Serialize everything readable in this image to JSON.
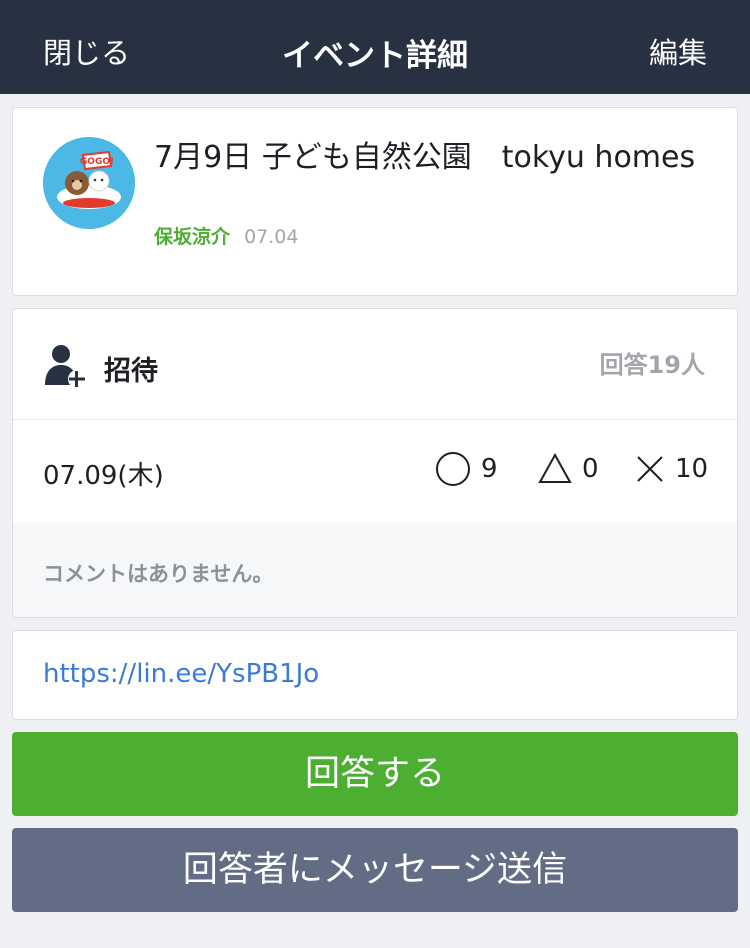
{
  "header": {
    "close_label": "閉じる",
    "title": "イベント詳細",
    "edit_label": "編集"
  },
  "event": {
    "title": "7月9日 子ども自然公園　tokyu homes",
    "author": "保坂涼介",
    "posted_date": "07.04",
    "avatar_badge": "GOGO!"
  },
  "attendance": {
    "invite_label": "招待",
    "reply_count": "回答19人",
    "date_label": "07.09(木)",
    "yes_count": "9",
    "maybe_count": "0",
    "no_count": "10",
    "comment_text": "コメントはありません。"
  },
  "link": {
    "url": "https://lin.ee/YsPB1Jo"
  },
  "actions": {
    "answer_label": "回答する",
    "message_label": "回答者にメッセージ送信"
  },
  "colors": {
    "header_bg": "#283142",
    "accent_green": "#4daf32",
    "link_blue": "#3a7bd5",
    "secondary_button": "#626c84"
  }
}
